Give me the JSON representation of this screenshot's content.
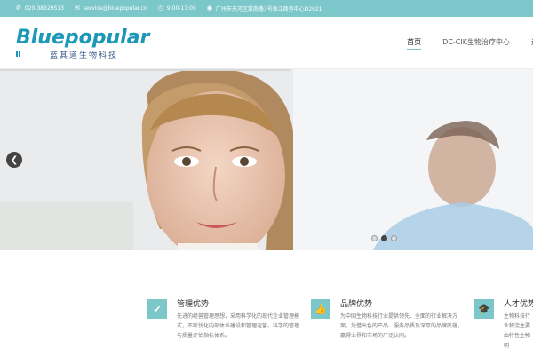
{
  "topbar": {
    "phone": "020-38329513",
    "email": "service@bluepopular.cn",
    "hours": "9:00-17:00",
    "address": "广州市天河区棠南路3号珠江商务中心D2021"
  },
  "logo": {
    "name": "Bluepopular",
    "subtitle": "蓝其道生物科技"
  },
  "nav": {
    "items": [
      {
        "label": "首页"
      },
      {
        "label": "DC-CIK生物治疗中心"
      },
      {
        "label": "运"
      }
    ]
  },
  "hero": {
    "slide_count": 3,
    "active_slide": 2
  },
  "features": [
    {
      "title": "管理优势",
      "icon": "check-icon",
      "desc": "先进的经营管理思想，采用科学化的现代企业管理模式，不断优化内部体系建设和管理运营。科学的管理与质量评估指标体系。"
    },
    {
      "title": "品牌优势",
      "icon": "thumbs-up-icon",
      "desc": "为中国生物科技行业提供领先、全面的行业解决方案，凭借出色的产品、服务品质及深厚的品牌底蕴，赢得业界和市场的广泛认同。"
    },
    {
      "title": "人才优势",
      "icon": "graduation-cap-icon",
      "desc": "生物科技行业积淀主要由特性生物明"
    }
  ],
  "colors": {
    "accent": "#7cc7c9",
    "brand": "#1b97b7"
  }
}
